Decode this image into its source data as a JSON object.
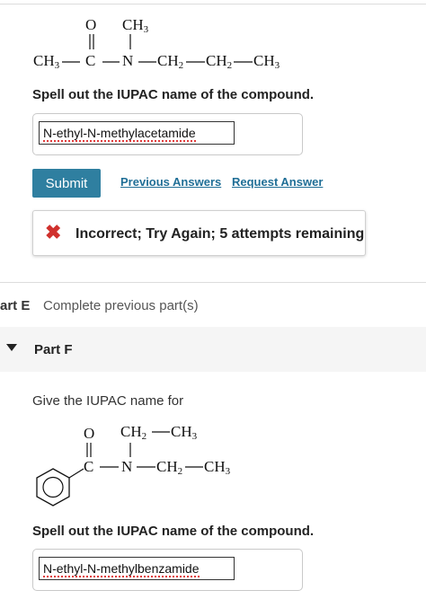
{
  "part_d": {
    "molecule": {
      "o": "O",
      "ch3_top_main": "CH",
      "ch3_top_sub": "3",
      "ch3_left_main": "CH",
      "ch3_left_sub": "3",
      "c": "C",
      "n": "N",
      "ch2_a_main": "CH",
      "ch2_a_sub": "2",
      "ch2_b_main": "CH",
      "ch2_b_sub": "2",
      "ch3_right_main": "CH",
      "ch3_right_sub": "3"
    },
    "prompt": "Spell out the IUPAC name of the compound.",
    "answer_value": "N-ethyl-N-methylacetamide",
    "submit_label": "Submit",
    "previous_answers_label": "Previous Answers",
    "request_answer_label": "Request Answer",
    "feedback_icon": "✖",
    "feedback_text": "Incorrect; Try Again; 5 attempts remaining"
  },
  "part_e": {
    "label": "art E",
    "status": "Complete previous part(s)"
  },
  "part_f": {
    "title": "Part F",
    "intro": "Give the IUPAC name for",
    "molecule": {
      "o": "O",
      "ch2_top_main": "CH",
      "ch2_top_sub": "2",
      "ch3_top_main": "CH",
      "ch3_top_sub": "3",
      "c": "C",
      "n": "N",
      "ch2_main": "CH",
      "ch2_sub": "2",
      "ch3_main": "CH",
      "ch3_sub": "3"
    },
    "prompt": "Spell out the IUPAC name of the compound.",
    "answer_value": "N-ethyl-N-methylbenzamide"
  }
}
